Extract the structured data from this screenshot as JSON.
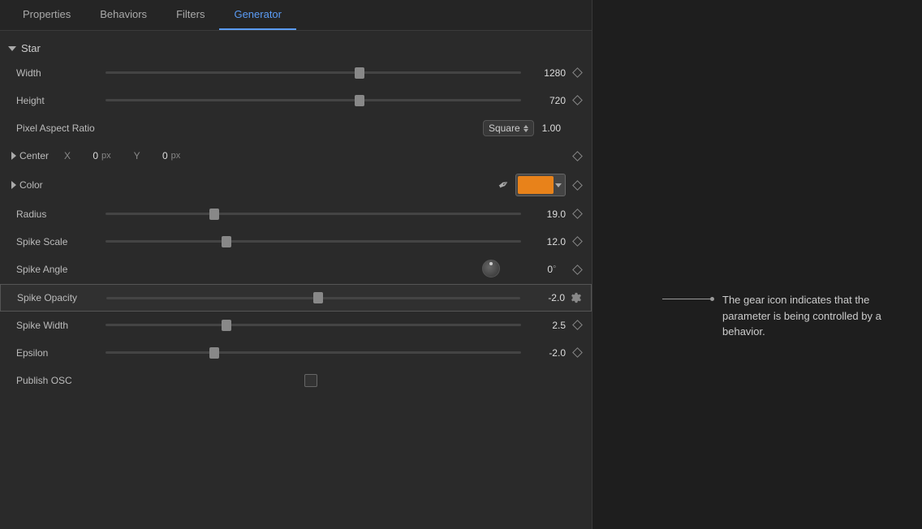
{
  "tabs": [
    {
      "label": "Properties",
      "active": false
    },
    {
      "label": "Behaviors",
      "active": false
    },
    {
      "label": "Filters",
      "active": false
    },
    {
      "label": "Generator",
      "active": true
    }
  ],
  "section": {
    "name": "Star",
    "expanded": true
  },
  "properties": {
    "width": {
      "label": "Width",
      "value": "1280",
      "sliderPos": "60%"
    },
    "height": {
      "label": "Height",
      "value": "720",
      "sliderPos": "60%"
    },
    "pixelAspectRatio": {
      "label": "Pixel Aspect Ratio",
      "dropdown": "Square",
      "value": "1.00"
    },
    "center": {
      "label": "Center",
      "x": {
        "axis": "X",
        "value": "0",
        "unit": "px"
      },
      "y": {
        "axis": "Y",
        "value": "0",
        "unit": "px"
      }
    },
    "color": {
      "label": "Color"
    },
    "radius": {
      "label": "Radius",
      "value": "19.0",
      "sliderPos": "25%"
    },
    "spikeScale": {
      "label": "Spike Scale",
      "value": "12.0",
      "sliderPos": "28%"
    },
    "spikeAngle": {
      "label": "Spike Angle",
      "value": "0",
      "unit": "°",
      "sliderPos": "50%"
    },
    "spikeOpacity": {
      "label": "Spike Opacity",
      "value": "-2.0",
      "sliderPos": "50%",
      "highlighted": true
    },
    "spikeWidth": {
      "label": "Spike Width",
      "value": "2.5",
      "sliderPos": "28%"
    },
    "epsilon": {
      "label": "Epsilon",
      "value": "-2.0",
      "sliderPos": "25%"
    },
    "publishOSC": {
      "label": "Publish OSC"
    }
  },
  "annotation": {
    "text": "The gear icon indicates that the parameter is being controlled by a behavior."
  }
}
